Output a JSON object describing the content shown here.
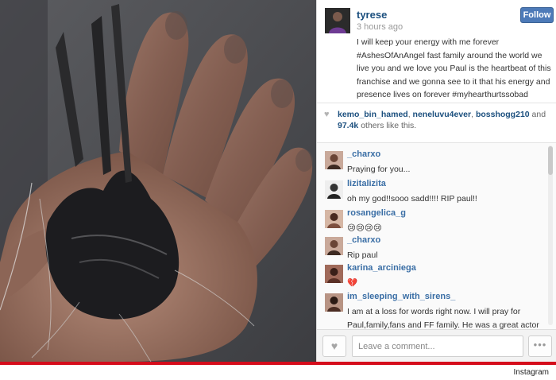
{
  "owner": {
    "username": "tyrese",
    "time": "3 hours ago",
    "follow_label": "Follow",
    "caption": "I will keep your energy with me forever #AshesOfAnAngel fast family around the world we live you and we love you Paul is the heartbeat of this franchise and we gonna see to it that his energy and presence lives on forever #myhearthurtssobad"
  },
  "likes": {
    "icon": "heart-icon",
    "user1": "kemo_bin_hamed",
    "sep1": ", ",
    "user2": "neneluvu4ever",
    "sep2": ", ",
    "user3": "bosshogg210",
    "and": " and",
    "count": "97.4k",
    "rest": " others like this."
  },
  "comments": [
    {
      "user": "_charxo",
      "text": "Praying for you..."
    },
    {
      "user": "lizitalizita",
      "text": "oh my god!!sooo sadd!!!! RIP paul!!"
    },
    {
      "user": "rosangelica_g",
      "text": "😢😢😢😢"
    },
    {
      "user": "_charxo",
      "text": "Rip paul"
    },
    {
      "user": "karina_arciniega",
      "text": "💔"
    },
    {
      "user": "im_sleeping_with_sirens_",
      "text": "I am at a loss for words right now. I will pray for Paul,family,fans and FF family. He was a great actor and was truly talented and kind-hearted"
    }
  ],
  "comment_bar": {
    "like_icon": "heart-icon",
    "placeholder": "Leave a comment...",
    "more_label": "•••"
  },
  "credit": "Instagram",
  "colors": {
    "username_blue": "#1b4f7e",
    "follow_button": "#4d7ab8",
    "brand_red": "#d50c1b"
  }
}
